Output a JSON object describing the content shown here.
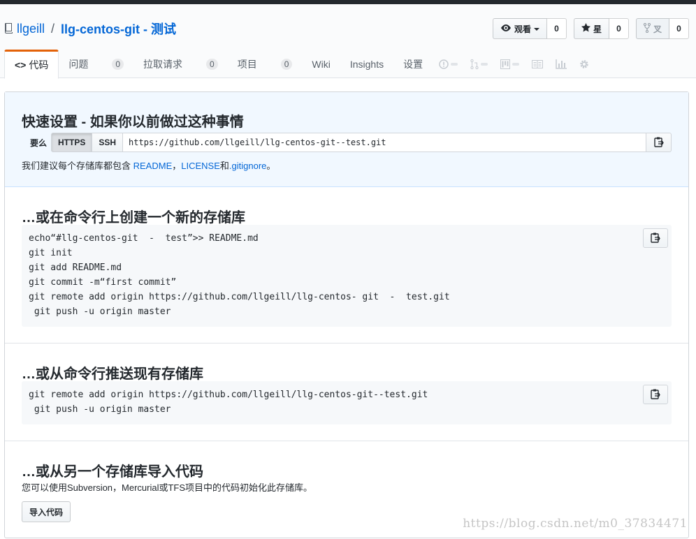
{
  "repo": {
    "owner": "llgeill",
    "separator": "/",
    "name": "llg-centos-git - 测试"
  },
  "actions": {
    "watch_label": "观看",
    "watch_count": "0",
    "star_label": "星",
    "star_count": "0",
    "fork_label": "叉",
    "fork_count": "0"
  },
  "tabs": [
    {
      "label": "代码",
      "counter": ""
    },
    {
      "label": "问题",
      "counter": "0"
    },
    {
      "label": "拉取请求",
      "counter": "0"
    },
    {
      "label": "项目",
      "counter": "0"
    },
    {
      "label": "Wiki",
      "counter": ""
    },
    {
      "label": "Insights",
      "counter": ""
    },
    {
      "label": "设置",
      "counter": ""
    }
  ],
  "icon_tabs": [
    "issue-icon",
    "pull-request-icon",
    "project-icon",
    "wiki-icon",
    "graph-icon",
    "gear-icon"
  ],
  "quick_setup": {
    "title": "快速设置 - 如果你以前做过这种事情",
    "either_label": "要么",
    "https_label": "HTTPS",
    "ssh_label": "SSH",
    "clone_url": "https://github.com/llgeill/llg-centos-git--test.git",
    "recommend_prefix": "我们建议每个存储库都包含 ",
    "readme_link": "README",
    "comma": "，",
    "license_link": "LICENSE",
    "and": "和",
    "gitignore_link": ".gitignore",
    "period": "。"
  },
  "new_repo": {
    "title": "…或在命令行上创建一个新的存储库",
    "code": "echo“#llg-centos-git  -  test”>> README.md\ngit init\ngit add README.md\ngit commit -m“first commit”\ngit remote add origin https://github.com/llgeill/llg-centos- git  -  test.git\n git push -u origin master"
  },
  "push_existing": {
    "title": "…或从命令行推送现有存储库",
    "code": "git remote add origin https://github.com/llgeill/llg-centos-git--test.git\n git push -u origin master"
  },
  "import": {
    "title": "…或从另一个存储库导入代码",
    "description": "您可以使用Subversion，Mercurial或TFS项目中的代码初始化此存储库。",
    "button_label": "导入代码"
  },
  "watermark": "https://blog.csdn.net/m0_37834471",
  "colors": {
    "link": "#0366d6",
    "tab_accent": "#e36209",
    "quick_bg": "#f1f8ff",
    "code_bg": "#f6f8fa"
  }
}
